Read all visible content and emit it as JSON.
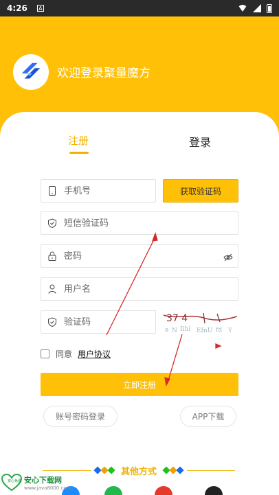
{
  "status_bar": {
    "time": "4:26",
    "notif_icon": "A"
  },
  "header": {
    "welcome": "欢迎登录聚量魔方",
    "logo_icon": "juliang-logo",
    "accent": "#ffc007"
  },
  "tabs": {
    "register": "注册",
    "login": "登录"
  },
  "form": {
    "phone": {
      "placeholder": "手机号"
    },
    "get_code": "获取验证码",
    "sms_code": {
      "placeholder": "短信验证码"
    },
    "password": {
      "placeholder": "密码"
    },
    "username": {
      "placeholder": "用户名"
    },
    "captcha": {
      "placeholder": "验证码"
    },
    "captcha_image_text": "37 4",
    "agree_prefix": "同意",
    "agree_link": "用户协议",
    "submit": "立即注册"
  },
  "alt_links": {
    "account_login": "账号密码登录",
    "app_download": "APP下载"
  },
  "other": {
    "label": "其他方式"
  },
  "watermark": {
    "title": "安心下载网",
    "url": "www.java8000.com",
    "badge": "安心免费"
  }
}
